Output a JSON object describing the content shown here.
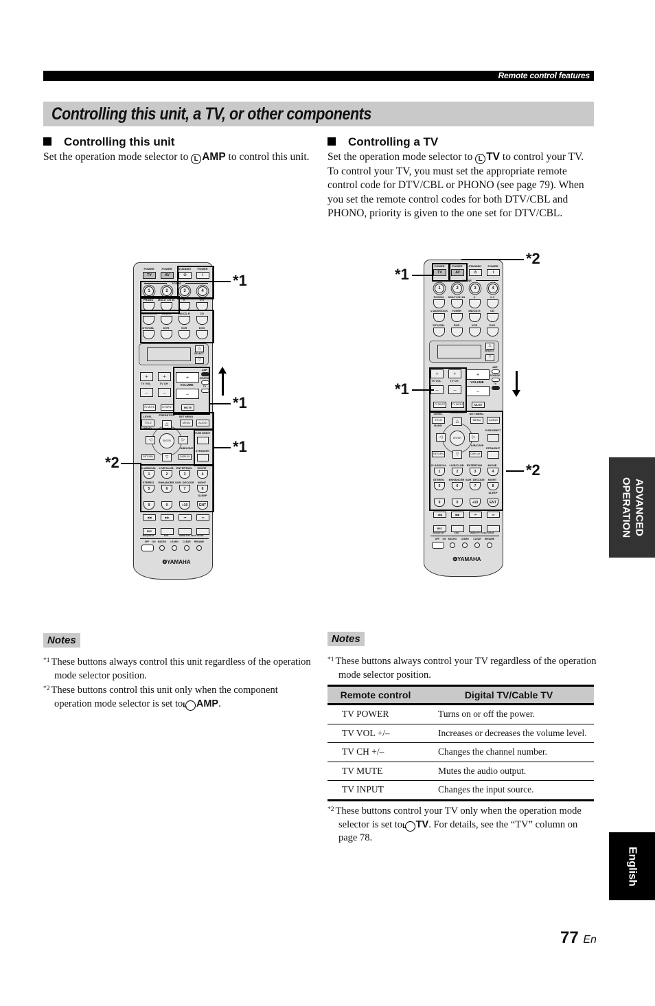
{
  "header": {
    "section_label": "Remote control features"
  },
  "page_title": "Controlling this unit, a TV, or other components",
  "left": {
    "heading": "Controlling this unit",
    "intro_pre": "Set the operation mode selector to ",
    "mode": "AMP",
    "intro_post": " to control this unit.",
    "notes_label": "Notes",
    "notes": [
      {
        "mark": "*1",
        "text": "These buttons always control this unit regardless of the operation mode selector position."
      },
      {
        "mark": "*2",
        "text_pre": "These buttons control this unit only when the component operation mode selector is set to ",
        "mode": "AMP",
        "text_post": "."
      }
    ]
  },
  "right": {
    "heading": "Controlling a TV",
    "intro_pre": "Set the operation mode selector to ",
    "mode": "TV",
    "intro_post": " to control your TV. To control your TV, you must set the appropriate remote control code for DTV/CBL or PHONO (see page 79). When you set the remote control codes for both DTV/CBL and PHONO, priority is given to the one set for DTV/CBL.",
    "notes_label": "Notes",
    "notes": [
      {
        "mark": "*1",
        "text": "These buttons always control your TV regardless of the operation mode selector position."
      },
      {
        "mark": "*2",
        "text_pre": "These buttons control your TV only when the operation mode selector is set to ",
        "mode": "TV",
        "text_post": ". For details, see the “TV” column on page 78."
      }
    ],
    "table": {
      "headers": [
        "Remote control",
        "Digital TV/Cable TV"
      ],
      "rows": [
        [
          "TV POWER",
          "Turns on or off the power."
        ],
        [
          "TV VOL +/–",
          "Increases or decreases the volume level."
        ],
        [
          "TV CH +/–",
          "Changes the channel number."
        ],
        [
          "TV MUTE",
          "Mutes the audio output."
        ],
        [
          "TV INPUT",
          "Changes the input source."
        ]
      ]
    }
  },
  "selector_letter": "L",
  "remote": {
    "power_labels": [
      "POWER",
      "POWER",
      "STANDBY",
      "POWER"
    ],
    "power_buttons": [
      "TV",
      "AV",
      "⏻",
      "I"
    ],
    "scene_label": "SCENE",
    "scene_buttons": [
      "1",
      "2",
      "3",
      "4"
    ],
    "input_row1": [
      "PHONO",
      "MULTI CH IN",
      "☆",
      "☆☆"
    ],
    "input_row2": [
      "V-AUX/DOCK",
      "TUNER",
      "MD/CD-R",
      "CD"
    ],
    "input_row3": [
      "DTV/CBL",
      "DVR",
      "VCR",
      "DVD"
    ],
    "select_label": "SELECT",
    "tv_vol": "TV VOL",
    "tv_ch": "TV CH",
    "volume": "VOLUME",
    "mode_labels": [
      "AMP",
      "SOURCE",
      "TV"
    ],
    "tv_mute": "TV MUTE",
    "tv_input": "TV INPUT",
    "mute": "MUTE",
    "level": "LEVEL",
    "preset_ch": "PRESET/CH",
    "set_menu": "SET MENU",
    "title": "TITLE",
    "menu": "MENU",
    "audio": "AUDIO",
    "band": "BAND",
    "enter": "ENTER",
    "ab_cde": "A/B/C/D/E",
    "pure_direct": "PURE DIRECT",
    "straight": "STRAIGHT",
    "return": "RETURN",
    "display": "DISPLAY",
    "mode_row1": [
      "CLASSICAL",
      "LIVE/CLUB",
      "ENTERTAIN",
      "MOVIE"
    ],
    "num_row1": [
      "1",
      "2",
      "3",
      "4"
    ],
    "mode_row2": [
      "STEREO",
      "ENHANCER",
      "SUR. DECODE",
      "NIGHT"
    ],
    "num_row2": [
      "5",
      "6",
      "7",
      "8"
    ],
    "sleep": "SLEEP",
    "num_row3": [
      "9",
      "0",
      "+10",
      "ENT"
    ],
    "transport1": [
      "◀◀",
      "▶▶",
      "⏮",
      "⏭"
    ],
    "rec": "REC",
    "transport_sub": [
      "FREQ/TEXT",
      "EON",
      "MODE PTY SEEK START"
    ],
    "bottom_labels": [
      "OFF",
      "ON",
      "MACRO",
      "LEARN",
      "CLEAR",
      "RENAME"
    ],
    "brand": "❂YAMAHA"
  },
  "callouts": {
    "left": [
      "*1",
      "*1",
      "*1",
      "*2"
    ],
    "right": [
      "*1",
      "*2",
      "*1",
      "*2"
    ]
  },
  "side_tabs": {
    "advanced": "ADVANCED OPERATION",
    "english": "English"
  },
  "page_number": "77",
  "page_lang": "En"
}
